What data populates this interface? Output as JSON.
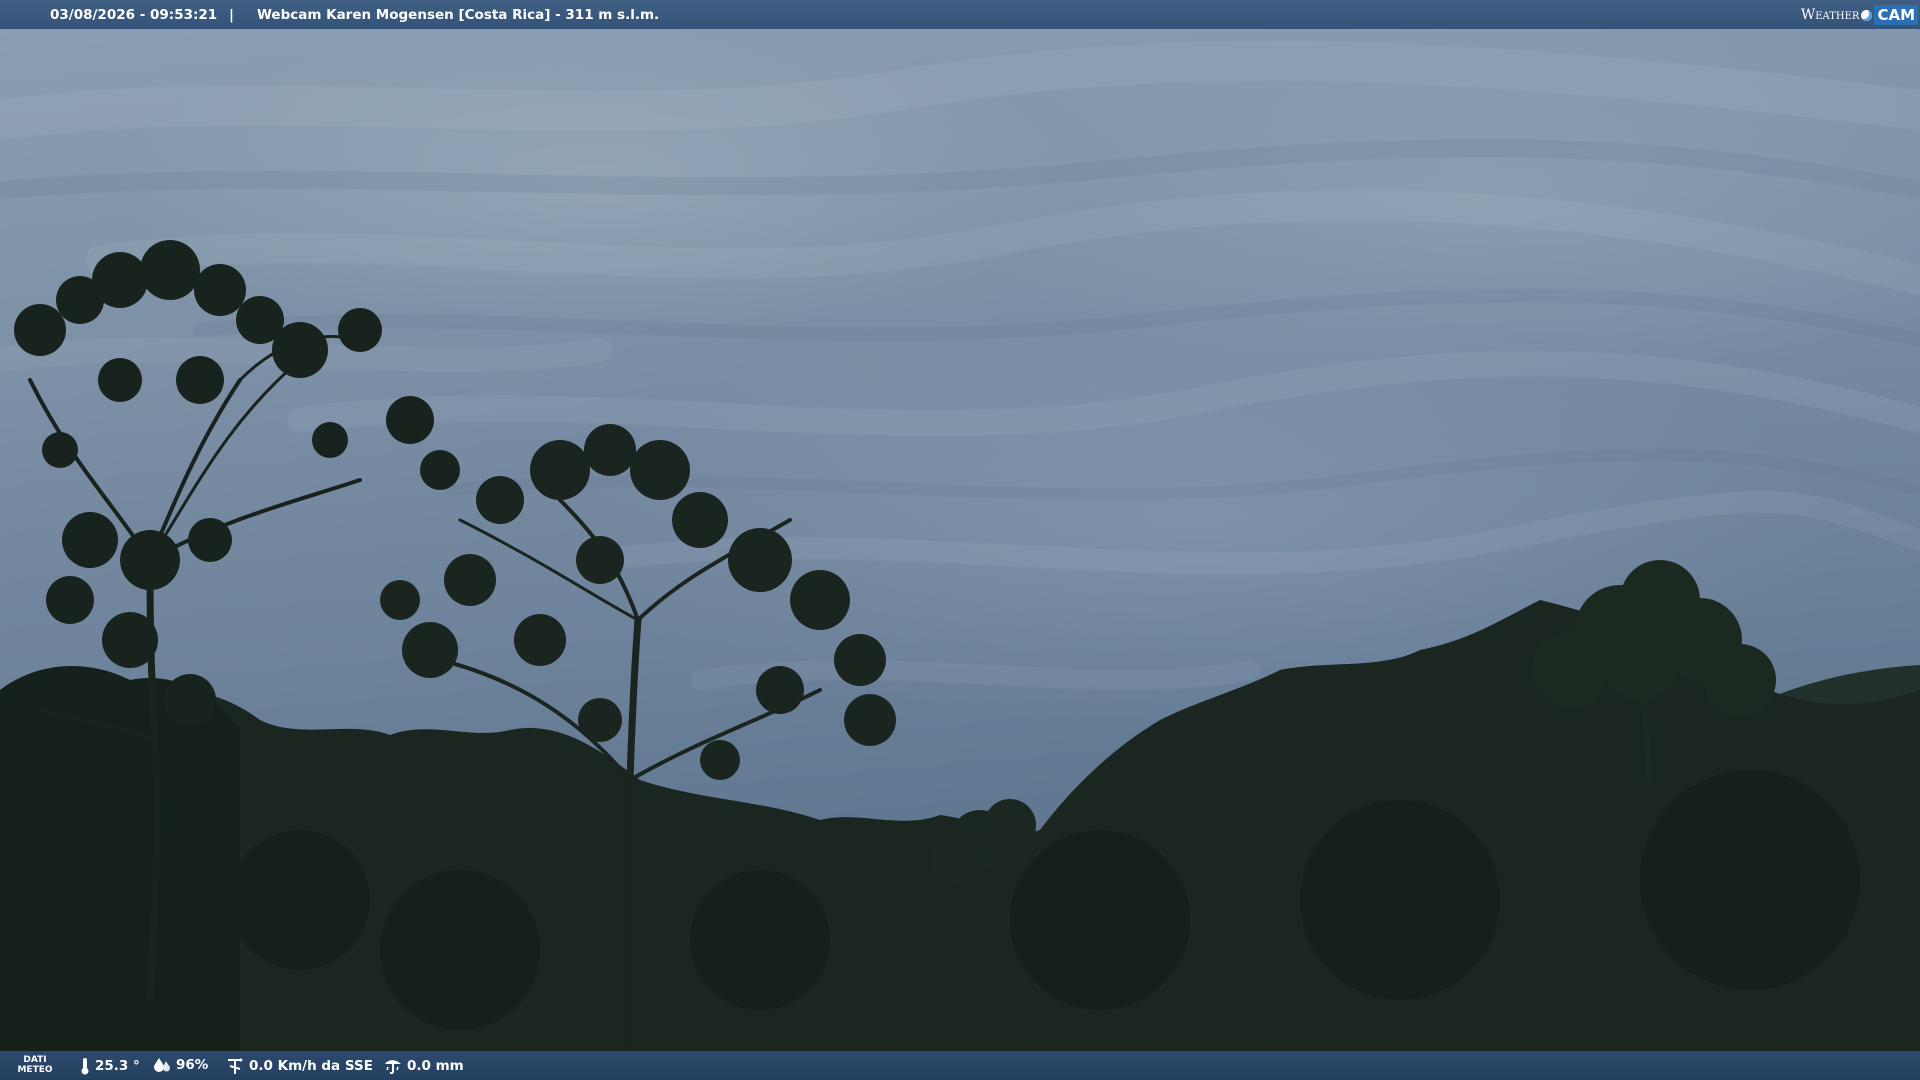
{
  "header": {
    "datetime": "03/08/2026 - 09:53:21",
    "separator": "|",
    "camera_title": "Webcam Karen Mogensen [Costa Rica] - 311 m s.l.m.",
    "logo": {
      "weather": "Weather",
      "cam": "CAM"
    }
  },
  "footer": {
    "dati_label_1": "DATI",
    "dati_label_2": "METEO",
    "temperature": "25.3 °",
    "humidity": "96%",
    "wind": "0.0 Km/h da SSE",
    "rain": "0.0 mm",
    "icons": [
      "thermometer-icon",
      "humidity-icon",
      "wind-icon",
      "rain-gauge-icon"
    ]
  },
  "colors": {
    "bar_top": "#3a5a7f",
    "bar_bottom": "#24415f",
    "sky": "#7c90a6",
    "foliage": "#1a261f"
  }
}
